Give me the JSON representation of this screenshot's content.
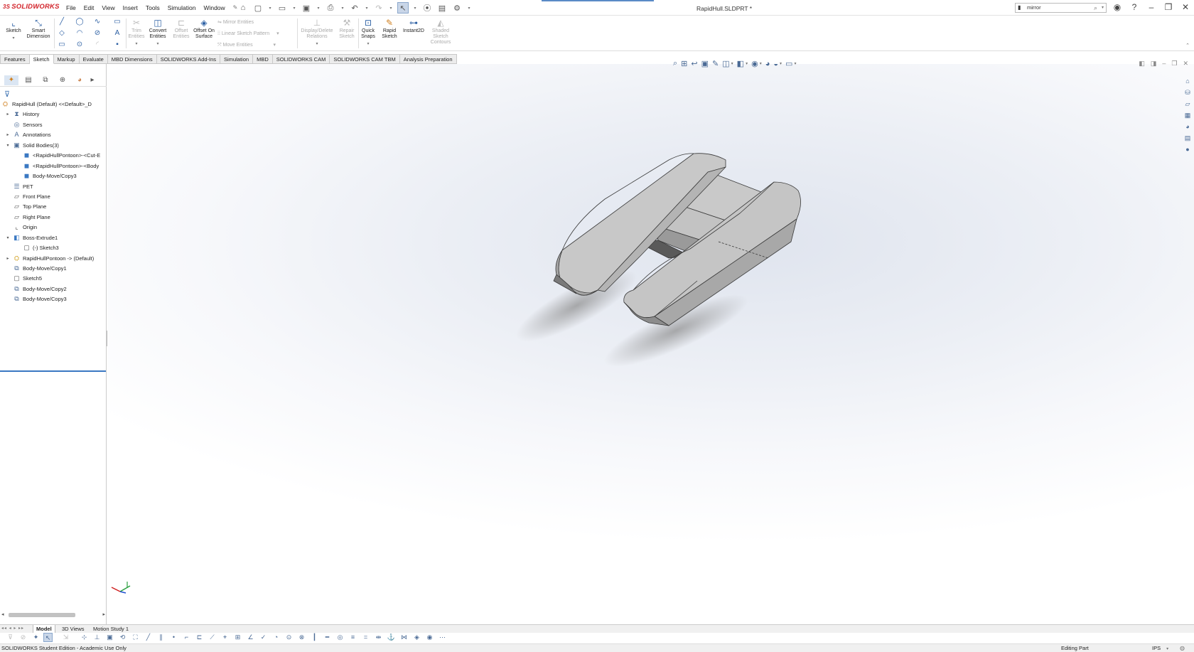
{
  "app": {
    "brand": "SOLIDWORKS",
    "document_title": "RapidHull.SLDPRT *",
    "menu": [
      "File",
      "Edit",
      "View",
      "Insert",
      "Tools",
      "Simulation",
      "Window"
    ],
    "search": {
      "value": "mirror",
      "placeholder": ""
    }
  },
  "commands": {
    "sketch": "Sketch",
    "smart_dimension": "Smart Dimension",
    "trim": "Trim Entities",
    "convert": "Convert Entities",
    "offset": "Offset Entities",
    "offset_surface": "Offset On Surface",
    "mirror": "Mirror Entities",
    "linear_pattern": "Linear Sketch Pattern",
    "move": "Move Entities",
    "display_delete": "Display/Delete Relations",
    "repair": "Repair Sketch",
    "quick_snaps": "Quick Snaps",
    "rapid_sketch": "Rapid Sketch",
    "instant2d": "Instant2D",
    "shaded_contours": "Shaded Sketch Contours"
  },
  "tabs": [
    "Features",
    "Sketch",
    "Markup",
    "Evaluate",
    "MBD Dimensions",
    "SOLIDWORKS Add-Ins",
    "Simulation",
    "MBD",
    "SOLIDWORKS CAM",
    "SOLIDWORKS CAM TBM",
    "Analysis Preparation"
  ],
  "active_tab": "Sketch",
  "tree": [
    {
      "label": "RapidHull (Default) <<Default>_D",
      "icon": "part-icon",
      "level": 0,
      "expand": ""
    },
    {
      "label": "History",
      "icon": "history-icon",
      "level": 1,
      "expand": "▸"
    },
    {
      "label": "Sensors",
      "icon": "sensor-icon",
      "level": 1,
      "expand": ""
    },
    {
      "label": "Annotations",
      "icon": "annotation-icon",
      "level": 1,
      "expand": "▸"
    },
    {
      "label": "Solid Bodies(3)",
      "icon": "solid-bodies-icon",
      "level": 1,
      "expand": "▾"
    },
    {
      "label": "<RapidHullPontoon>-<Cut-E",
      "icon": "body-icon",
      "level": 2,
      "expand": ""
    },
    {
      "label": "<RapidHullPontoon>-<Body",
      "icon": "body-icon",
      "level": 2,
      "expand": ""
    },
    {
      "label": "Body-Move/Copy3",
      "icon": "body-icon",
      "level": 2,
      "expand": ""
    },
    {
      "label": "PET",
      "icon": "material-icon",
      "level": 1,
      "expand": ""
    },
    {
      "label": "Front Plane",
      "icon": "plane-icon",
      "level": 1,
      "expand": ""
    },
    {
      "label": "Top Plane",
      "icon": "plane-icon",
      "level": 1,
      "expand": ""
    },
    {
      "label": "Right Plane",
      "icon": "plane-icon",
      "level": 1,
      "expand": ""
    },
    {
      "label": "Origin",
      "icon": "origin-icon",
      "level": 1,
      "expand": ""
    },
    {
      "label": "Boss-Extrude1",
      "icon": "extrude-icon",
      "level": 1,
      "expand": "▾"
    },
    {
      "label": "(-) Sketch3",
      "icon": "sketch-icon",
      "level": 2,
      "expand": ""
    },
    {
      "label": "RapidHullPontoon -> (Default)",
      "icon": "derived-part-icon",
      "level": 1,
      "expand": "▸"
    },
    {
      "label": "Body-Move/Copy1",
      "icon": "move-copy-icon",
      "level": 1,
      "expand": ""
    },
    {
      "label": "Sketch5",
      "icon": "sketch-icon",
      "level": 1,
      "expand": ""
    },
    {
      "label": "Body-Move/Copy2",
      "icon": "move-copy-icon",
      "level": 1,
      "expand": ""
    },
    {
      "label": "Body-Move/Copy3",
      "icon": "move-copy-icon",
      "level": 1,
      "expand": ""
    }
  ],
  "bottom_tabs": [
    "Model",
    "3D Views",
    "Motion Study 1"
  ],
  "status": {
    "left": "SOLIDWORKS Student Edition - Academic Use Only",
    "mode": "Editing Part",
    "units": "IPS"
  },
  "colors": {
    "accent": "#3a78c2",
    "brand": "#d2232a",
    "viewport_gradient": "#dfe4ee",
    "model_face": "#c4c4c4"
  }
}
